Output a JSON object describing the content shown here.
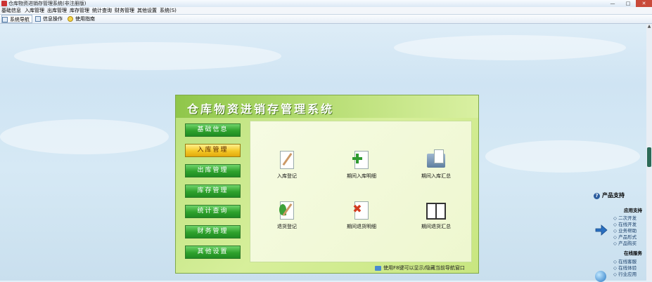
{
  "window": {
    "title": "仓库物资进销存管理系统(非注册版)",
    "controls": {
      "minimize": "—",
      "maximize": "□",
      "close": "✕"
    }
  },
  "menubar": [
    "基础信息",
    "入库管理",
    "出库管理",
    "库存管理",
    "统计查询",
    "财务管理",
    "其他设置",
    "系统(S)"
  ],
  "toolbar": [
    "系统导航",
    "信息操作",
    "使用指南"
  ],
  "panel": {
    "title": "仓库物资进销存管理系统",
    "nav": [
      "基础信息",
      "入库管理",
      "出库管理",
      "库存管理",
      "统计查询",
      "财务管理",
      "其他设置"
    ],
    "active_nav": "入库管理",
    "functions": [
      {
        "label": "入库登记",
        "icon": "ledger-pen-icon"
      },
      {
        "label": "期间入库明细",
        "icon": "document-add-icon"
      },
      {
        "label": "期间入库汇总",
        "icon": "folder-summary-icon"
      },
      {
        "label": "退货登记",
        "icon": "plant-pen-icon"
      },
      {
        "label": "期间退货明细",
        "icon": "document-delete-icon"
      },
      {
        "label": "期间退货汇总",
        "icon": "book-icon"
      }
    ],
    "footer_note": "使用F8键可以显示/隐藏当前导航窗口"
  },
  "side": {
    "heading": "产品支持",
    "sections": [
      {
        "title": "应用支持",
        "items": [
          "二次开发",
          "在线开发",
          "业务帮助",
          "产品形式",
          "产品购买"
        ]
      },
      {
        "title": "在线服务",
        "items": [
          "在线客服",
          "在线体验",
          "行业应用"
        ]
      }
    ]
  },
  "colors": {
    "panel_green": "#b9e07a",
    "nav_green": "#2ea12c",
    "nav_active": "#f3c726",
    "close_red": "#c94a3a"
  }
}
